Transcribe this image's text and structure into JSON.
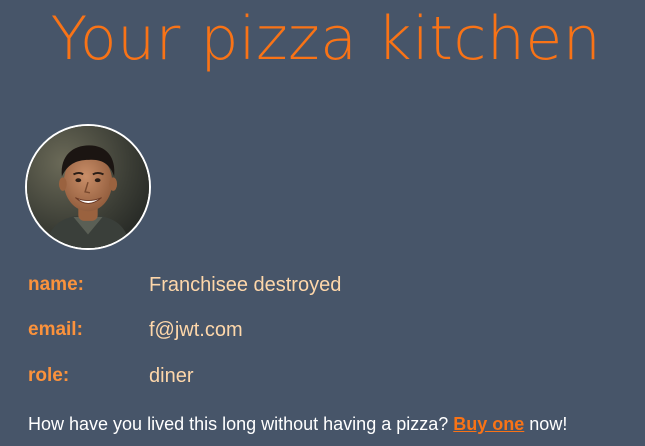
{
  "header": {
    "title": "Your pizza kitchen"
  },
  "profile": {
    "avatar_icon": "user-avatar-photo",
    "fields": [
      {
        "label": "name:",
        "value": "Franchisee destroyed"
      },
      {
        "label": "email:",
        "value": "f@jwt.com"
      },
      {
        "label": "role:",
        "value": "diner"
      }
    ]
  },
  "cta": {
    "prefix": "How have you lived this long without having a pizza?",
    "link_label": "Buy one",
    "suffix": "now!"
  },
  "colors": {
    "background": "#475569",
    "accent": "#f97316",
    "label": "#fb923c",
    "value": "#fed7aa"
  }
}
